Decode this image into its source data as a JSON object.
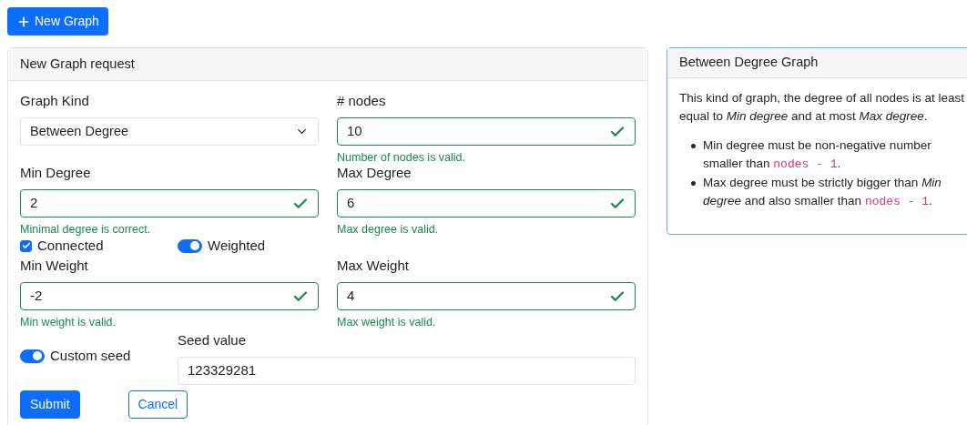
{
  "new_graph_button": {
    "label": "New Graph"
  },
  "request_card": {
    "title": "New Graph request",
    "graph_kind": {
      "label": "Graph Kind",
      "value": "Between Degree"
    },
    "nodes": {
      "label": "# nodes",
      "value": "10",
      "valid": true,
      "feedback": "Number of nodes is valid."
    },
    "min_degree": {
      "label": "Min Degree",
      "value": "2",
      "valid": true,
      "feedback": "Minimal degree is correct."
    },
    "max_degree": {
      "label": "Max Degree",
      "value": "6",
      "valid": true,
      "feedback": "Max degree is valid."
    },
    "connected": {
      "label": "Connected",
      "checked": true
    },
    "weighted": {
      "label": "Weighted",
      "on": true
    },
    "min_weight": {
      "label": "Min Weight",
      "value": "-2",
      "valid": true,
      "feedback": "Min weight is valid."
    },
    "max_weight": {
      "label": "Max Weight",
      "value": "4",
      "valid": true,
      "feedback": "Max weight is valid."
    },
    "custom_seed": {
      "label": "Custom seed",
      "on": true
    },
    "seed": {
      "label": "Seed value",
      "value": "123329281"
    },
    "buttons": [
      {
        "label": "Submit",
        "kind": "primary"
      },
      {
        "label": "Cancel",
        "kind": "outline"
      }
    ]
  },
  "info_card": {
    "title": "Between Degree Graph",
    "paragraph": [
      {
        "kind": "text",
        "text": "This kind of graph, the degree of all nodes is at least equal to "
      },
      {
        "kind": "em",
        "text": "Min degree"
      },
      {
        "kind": "text",
        "text": " and at most "
      },
      {
        "kind": "em",
        "text": "Max degree"
      },
      {
        "kind": "text",
        "text": "."
      }
    ],
    "bullets": [
      [
        {
          "kind": "text",
          "text": "Min degree must be non-negative number smaller than "
        },
        {
          "kind": "code",
          "text": "nodes - 1"
        },
        {
          "kind": "text",
          "text": "."
        }
      ],
      [
        {
          "kind": "text",
          "text": "Max degree must be strictly bigger than "
        },
        {
          "kind": "em",
          "text": "Min degree"
        },
        {
          "kind": "text",
          "text": " and also smaller than "
        },
        {
          "kind": "code",
          "text": "nodes - 1"
        },
        {
          "kind": "text",
          "text": "."
        }
      ]
    ]
  }
}
